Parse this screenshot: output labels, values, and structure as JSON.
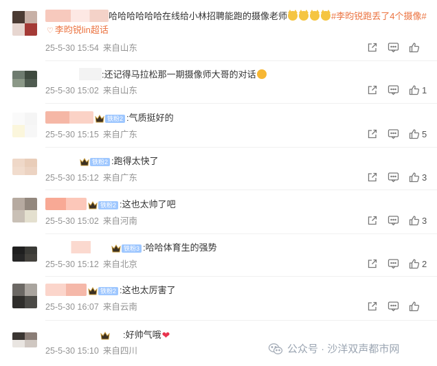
{
  "comments": [
    {
      "parts": [
        "哈哈哈哈哈哈在线给小林招聘能跑的摄像老师",
        "#李昀锐跑丢了4个摄像#",
        "李昀锐lin超话"
      ],
      "date": "25-5-30 15:54",
      "location": "来自山东",
      "likes": ""
    },
    {
      "parts": [
        ":还记得马拉松那一期摄像师大哥的对话"
      ],
      "date": "25-5-30 15:02",
      "location": "来自山东",
      "likes": "1"
    },
    {
      "badge": "铁粉2",
      "parts": [
        ":气质挺好的"
      ],
      "date": "25-5-30 15:15",
      "location": "来自广东",
      "likes": "5"
    },
    {
      "badge": "铁粉2",
      "parts": [
        ":跑得太快了"
      ],
      "date": "25-5-30 15:12",
      "location": "来自广东",
      "likes": "3"
    },
    {
      "badge": "铁粉2",
      "parts": [
        ":这也太帅了吧"
      ],
      "date": "25-5-30 15:02",
      "location": "来自河南",
      "likes": "3"
    },
    {
      "badge": "铁粉3",
      "parts": [
        ":哈哈体育生的强势"
      ],
      "date": "25-5-30 15:12",
      "location": "来自北京",
      "likes": "2"
    },
    {
      "badge": "铁粉2",
      "parts": [
        ":这也太厉害了"
      ],
      "date": "25-5-30 16:07",
      "location": "来自云南",
      "likes": ""
    },
    {
      "parts": [
        ":好帅气哦"
      ],
      "date": "25-5-30 15:10",
      "location": "来自四川",
      "likes": ""
    }
  ],
  "watermark": {
    "text": "公众号 · 沙洋双声都市网"
  },
  "icons": {
    "share": "share-icon",
    "comment": "comment-icon",
    "like": "thumbs-up-icon",
    "crown": "crown-icon",
    "wechat": "wechat-icon"
  },
  "colors": {
    "topic": "#eb7340",
    "meta": "#939393",
    "badge": "#9ec7ff"
  }
}
